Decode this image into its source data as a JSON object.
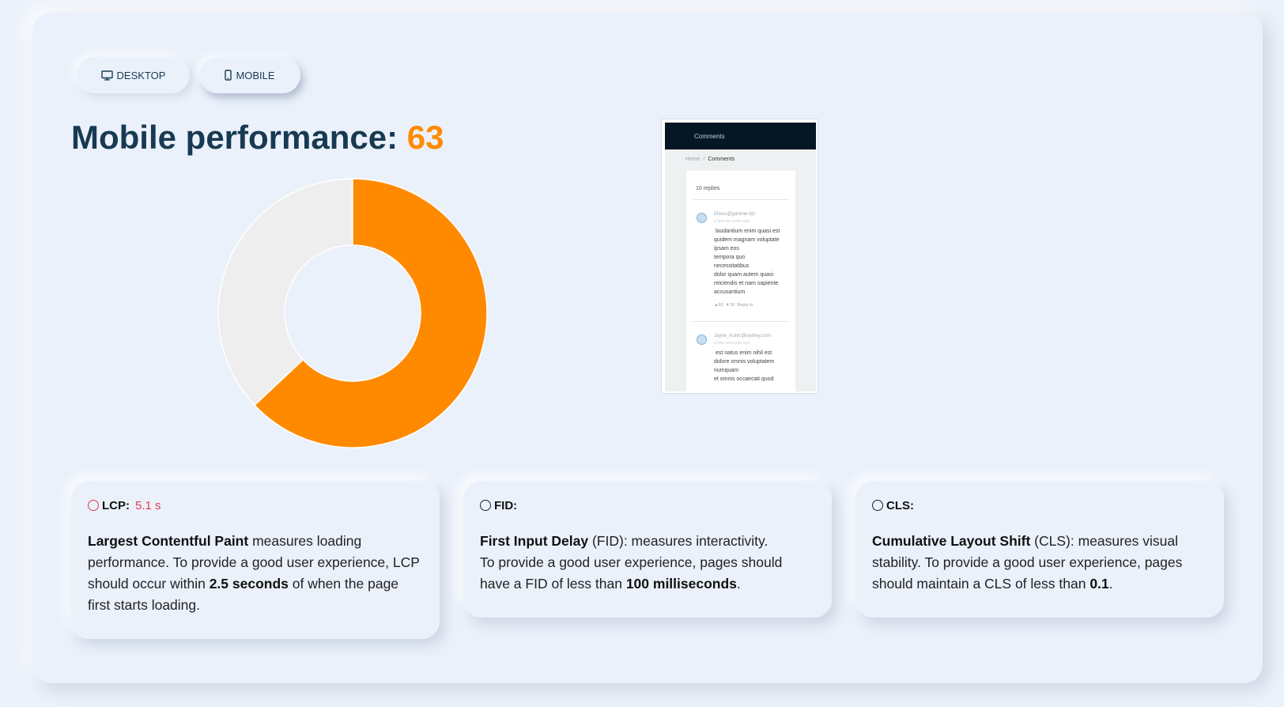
{
  "tabs": [
    {
      "label": "DESKTOP",
      "icon": "monitor-icon",
      "selected": false
    },
    {
      "label": "MOBILE",
      "icon": "smartphone-icon",
      "selected": true
    }
  ],
  "heading": {
    "prefix": "Mobile performance:",
    "score": "63",
    "score_color": "#ff8a00"
  },
  "score_chart": {
    "value": 63,
    "max": 100,
    "fill_color": "#ff8a00",
    "track_color": "#eeeeee"
  },
  "screenshot": {
    "header_text": "Comments",
    "breadcrumb_home": "Home",
    "breadcrumb_sep": "/",
    "breadcrumb_current": "Comments",
    "replies": "10 replies",
    "comments": [
      {
        "email": "Eliseo@gardner.biz",
        "ago": "a few seconds ago",
        "lines": [
          "laudantium enim quasi est",
          "quidem magnam voluptate",
          "ipsam eos",
          "tempora quo",
          "necessitatibus",
          "dolor quam autem quasi",
          "reiciendis et nam sapiente",
          "accusantium"
        ],
        "likes": "60",
        "dislikes": "30",
        "reply": "Reply to"
      },
      {
        "email": "Jayne_Kuhic@sydney.com",
        "ago": "a few seconds ago",
        "lines": [
          "est natus enim nihil est",
          "dolore omnis voluptatem",
          "numquam",
          "et omnis occaecati quod"
        ]
      }
    ]
  },
  "metrics": {
    "lcp": {
      "label": "LCP:",
      "value": "5.1 s",
      "status_color": "#e53950",
      "term": "Largest Contentful Paint",
      "text1": " measures loading performance. To provide a good user experience, LCP should occur within ",
      "threshold": "2.5 seconds",
      "text2": " of when the page first starts loading."
    },
    "fid": {
      "label": "FID:",
      "term": "First Input Delay",
      "text1": " (FID): measures interactivity.",
      "text2": "To provide a good user experience, pages should have a FID of less than ",
      "threshold": "100 milliseconds",
      "text3": "."
    },
    "cls": {
      "label": "CLS:",
      "term": "Cumulative Layout Shift",
      "text1": " (CLS): measures visual stability. To provide a good user experience, pages should maintain a CLS of less than ",
      "threshold": "0.1",
      "text2": "."
    }
  }
}
